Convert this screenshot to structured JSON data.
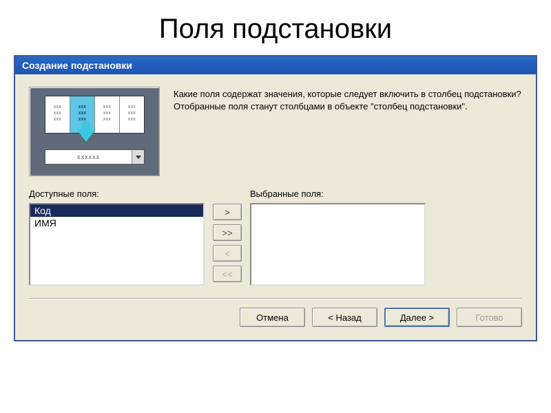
{
  "page_title": "Поля подстановки",
  "dialog": {
    "title": "Создание подстановки",
    "instruction": "Какие поля содержат значения, которые следует включить в столбец подстановки? Отобранные поля станут столбцами в объекте \"столбец подстановки\".",
    "available_label": "Доступные поля:",
    "selected_label": "Выбранные поля:",
    "available_items": [
      "Код",
      "ИМЯ"
    ],
    "selected_available_index": 0,
    "selected_items": [],
    "preview_placeholder": "xxxxxx",
    "buttons": {
      "move_one": ">",
      "move_all": ">>",
      "remove_one": "<",
      "remove_all": "<<",
      "cancel": "Отмена",
      "back": "< Назад",
      "next": "Далее >",
      "finish": "Готово"
    }
  }
}
